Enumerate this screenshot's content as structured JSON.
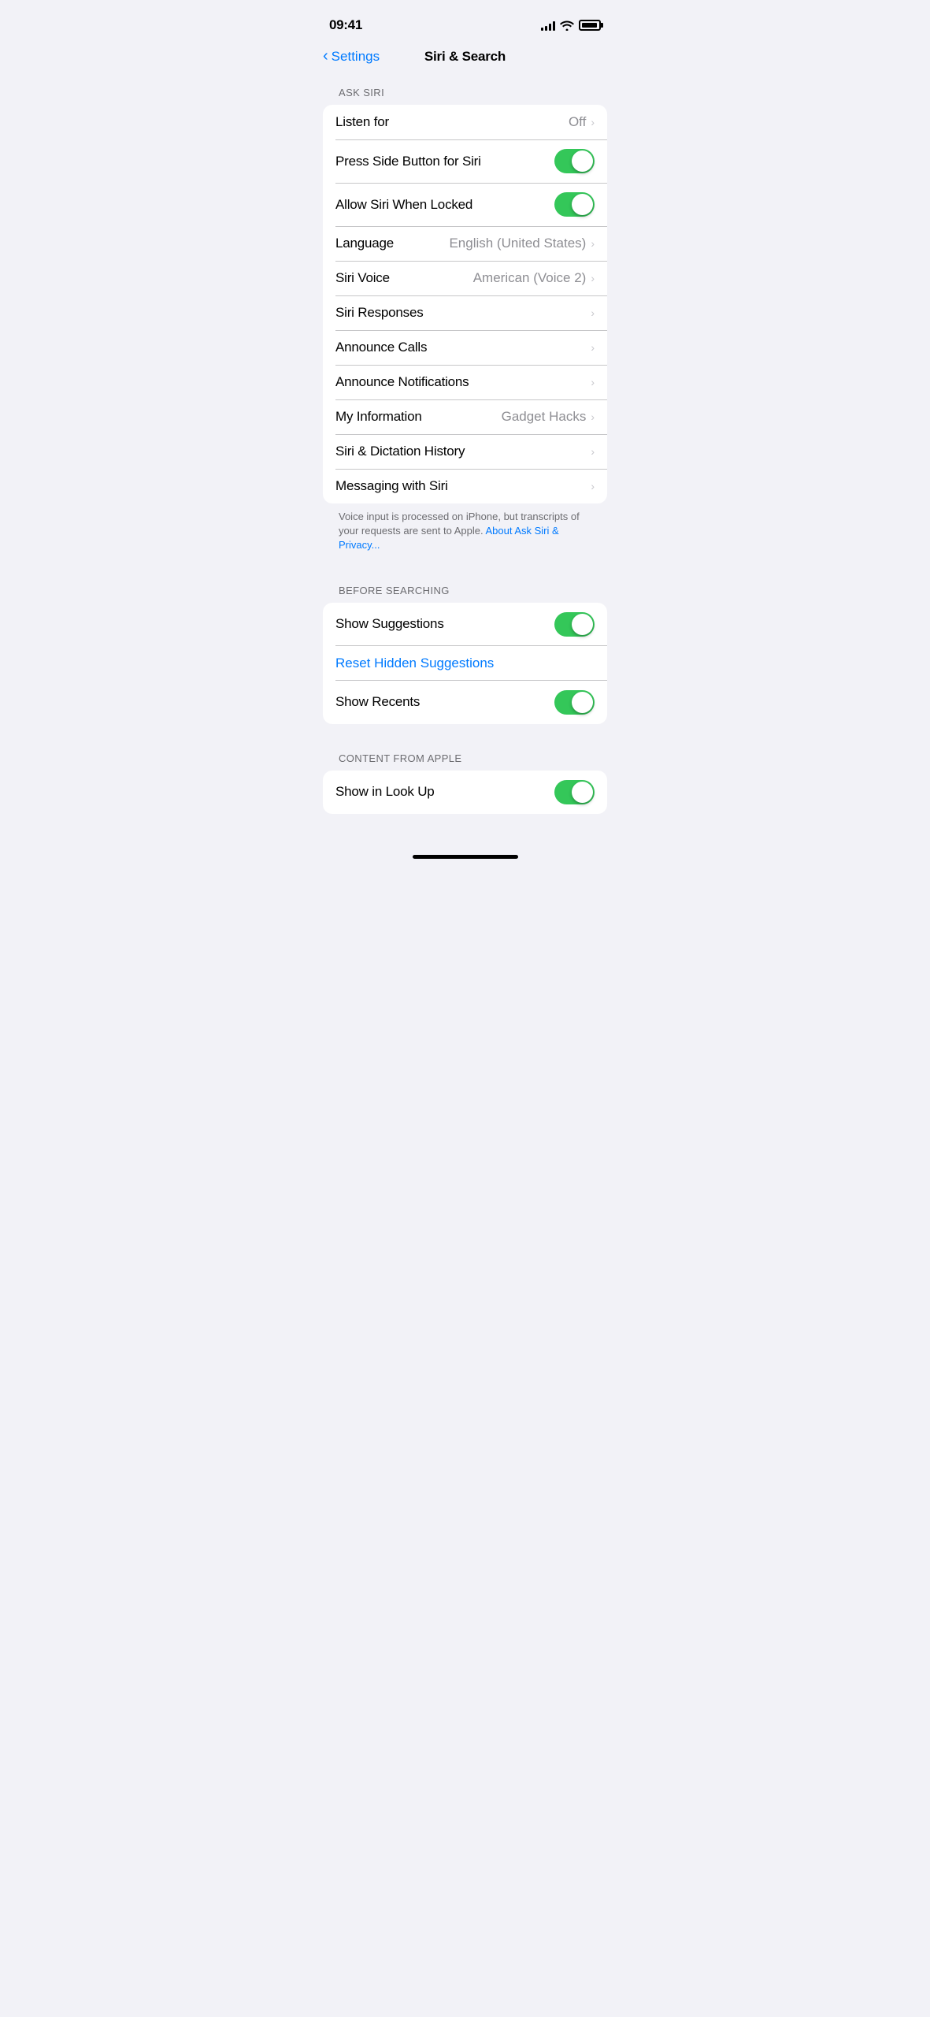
{
  "statusBar": {
    "time": "09:41",
    "signalBars": [
      4,
      6,
      8,
      11,
      14
    ],
    "batteryFull": true
  },
  "navigation": {
    "backLabel": "Settings",
    "title": "Siri & Search"
  },
  "sections": {
    "askSiri": {
      "header": "ASK SIRI",
      "rows": [
        {
          "id": "listen-for",
          "label": "Listen for",
          "value": "Off",
          "type": "chevron"
        },
        {
          "id": "press-side-button",
          "label": "Press Side Button for Siri",
          "value": null,
          "type": "toggle",
          "toggleOn": true
        },
        {
          "id": "allow-when-locked",
          "label": "Allow Siri When Locked",
          "value": null,
          "type": "toggle",
          "toggleOn": true
        },
        {
          "id": "language",
          "label": "Language",
          "value": "English (United States)",
          "type": "chevron"
        },
        {
          "id": "siri-voice",
          "label": "Siri Voice",
          "value": "American (Voice 2)",
          "type": "chevron"
        },
        {
          "id": "siri-responses",
          "label": "Siri Responses",
          "value": null,
          "type": "chevron"
        },
        {
          "id": "announce-calls",
          "label": "Announce Calls",
          "value": null,
          "type": "chevron"
        },
        {
          "id": "announce-notifications",
          "label": "Announce Notifications",
          "value": null,
          "type": "chevron"
        },
        {
          "id": "my-information",
          "label": "My Information",
          "value": "Gadget Hacks",
          "type": "chevron"
        },
        {
          "id": "siri-dictation-history",
          "label": "Siri & Dictation History",
          "value": null,
          "type": "chevron"
        },
        {
          "id": "messaging-with-siri",
          "label": "Messaging with Siri",
          "value": null,
          "type": "chevron"
        }
      ],
      "footer": {
        "text": "Voice input is processed on iPhone, but transcripts of your requests are sent to Apple.",
        "linkText": "About Ask Siri & Privacy..."
      }
    },
    "beforeSearching": {
      "header": "BEFORE SEARCHING",
      "rows": [
        {
          "id": "show-suggestions",
          "label": "Show Suggestions",
          "value": null,
          "type": "toggle",
          "toggleOn": true
        },
        {
          "id": "reset-hidden",
          "label": "Reset Hidden Suggestions",
          "value": null,
          "type": "action"
        },
        {
          "id": "show-recents",
          "label": "Show Recents",
          "value": null,
          "type": "toggle",
          "toggleOn": true
        }
      ]
    },
    "contentFromApple": {
      "header": "CONTENT FROM APPLE",
      "rows": [
        {
          "id": "show-in-look-up",
          "label": "Show in Look Up",
          "value": null,
          "type": "toggle",
          "toggleOn": true
        }
      ]
    }
  }
}
